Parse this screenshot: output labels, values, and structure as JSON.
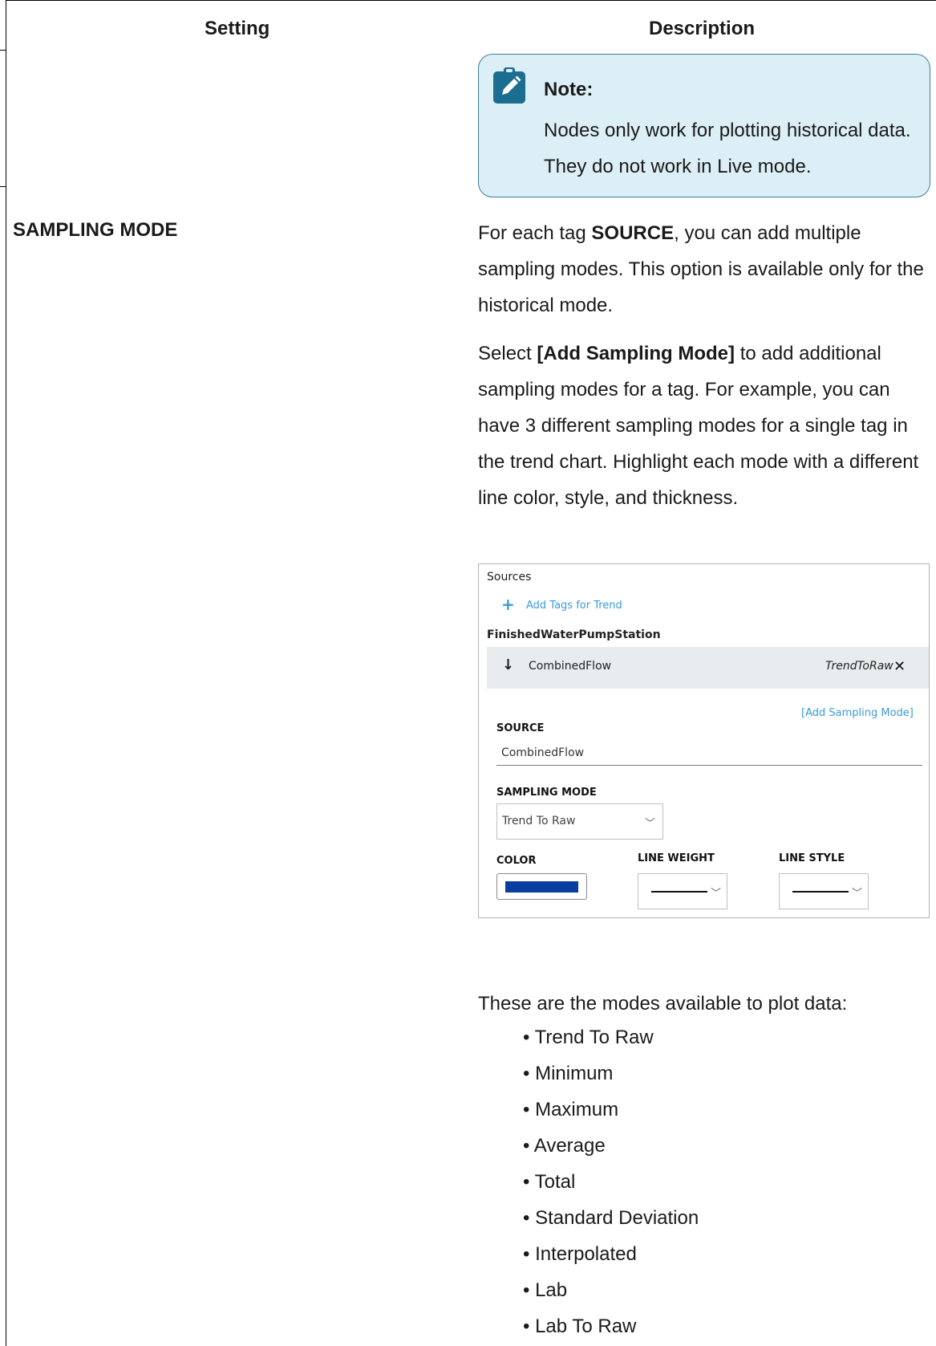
{
  "table": {
    "header_setting": "Setting",
    "header_description": "Description"
  },
  "note": {
    "title": "Note:",
    "text": "Nodes only work for plotting historical data. They do not work in Live mode.",
    "icon": "clipboard-pencil-icon",
    "background_color": "#dceef6",
    "border_color": "#3a7f9a"
  },
  "row": {
    "setting": "SAMPLING MODE",
    "para1": {
      "before": "For each tag ",
      "bold": "SOURCE",
      "after": ", you can add multiple sampling modes. This option is available only for the historical mode."
    },
    "para2": {
      "before": "Select ",
      "bold": "[Add Sampling Mode]",
      "after": " to add additional sampling modes for a tag. For example, you can have 3 different sampling modes for a single tag in the trend chart. Highlight each mode with a different line color, style, and thickness."
    },
    "para3": "These are the modes available to plot data:",
    "modes": [
      "Trend To Raw",
      "Minimum",
      "Maximum",
      "Average",
      "Total",
      "Standard Deviation",
      "Interpolated",
      "Lab",
      "Lab To Raw"
    ]
  },
  "screenshot": {
    "sources_label": "Sources",
    "add_tags_label": "Add Tags for Trend",
    "station_name": "FinishedWaterPumpStation",
    "tag_name": "CombinedFlow",
    "tag_mode": "TrendToRaw",
    "add_sampling_mode_label": "[Add Sampling Mode]",
    "source_label": "SOURCE",
    "source_value": "CombinedFlow",
    "sampling_mode_label": "SAMPLING MODE",
    "sampling_mode_value": "Trend To Raw",
    "color_label": "COLOR",
    "line_weight_label": "LINE WEIGHT",
    "line_style_label": "LINE STYLE",
    "color_value": "#0a3da0",
    "accent_color": "#3a9ad9"
  }
}
